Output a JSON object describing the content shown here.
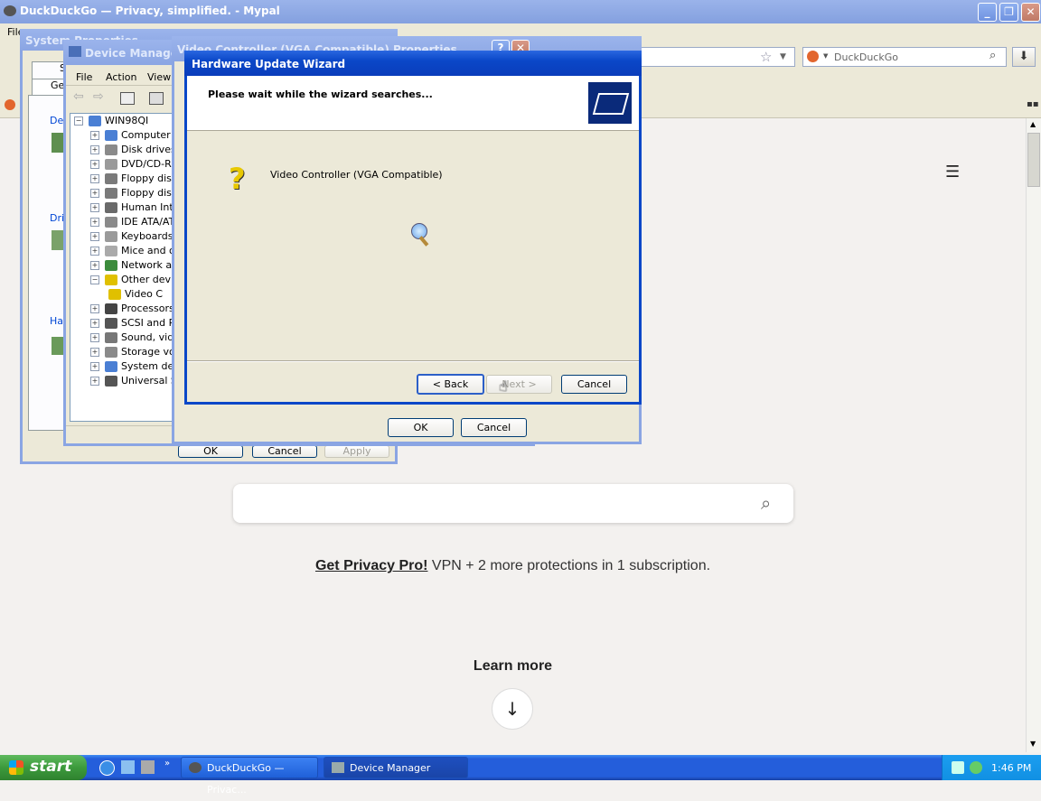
{
  "browser": {
    "title": "DuckDuckGo — Privacy, simplified. - Mypal",
    "menu_file": "File",
    "search_placeholder": "DuckDuckGo"
  },
  "ddg_page": {
    "privacy_link": "Get Privacy Pro!",
    "privacy_text": " VPN + 2 more protections in 1 subscription.",
    "learn_more": "Learn more"
  },
  "system_properties": {
    "title": "System Properties",
    "tab_partial": "Ge",
    "tab2_partial": "S",
    "group1": "Dev",
    "group2": "Driv",
    "group3": "Har",
    "ok": "OK",
    "cancel": "Cancel",
    "apply": "Apply"
  },
  "device_manager": {
    "title": "Device Manager",
    "menu": [
      "File",
      "Action",
      "View"
    ],
    "root": "WIN98QI",
    "items": [
      {
        "label": "Computer",
        "color": "#4a7fd4"
      },
      {
        "label": "Disk drives",
        "color": "#8a8a8a"
      },
      {
        "label": "DVD/CD-RO",
        "color": "#9a9a9a"
      },
      {
        "label": "Floppy disk",
        "color": "#7a7a7a"
      },
      {
        "label": "Floppy disk",
        "color": "#7a7a7a"
      },
      {
        "label": "Human Inte",
        "color": "#6a6a6a"
      },
      {
        "label": "IDE ATA/AT",
        "color": "#8a8a8a"
      },
      {
        "label": "Keyboards",
        "color": "#9a9a9a"
      },
      {
        "label": "Mice and ot",
        "color": "#aaaaaa"
      },
      {
        "label": "Network ac",
        "color": "#3c8c3c"
      },
      {
        "label": "Other devic",
        "color": "#e0c000"
      },
      {
        "label": "Video C",
        "color": "#e0c000"
      },
      {
        "label": "Processors",
        "color": "#444444"
      },
      {
        "label": "SCSI and R",
        "color": "#555555"
      },
      {
        "label": "Sound, vide",
        "color": "#777777"
      },
      {
        "label": "Storage vo",
        "color": "#8a8a8a"
      },
      {
        "label": "System dev",
        "color": "#4a7fd4"
      },
      {
        "label": "Universal S",
        "color": "#555555"
      }
    ]
  },
  "vga_properties": {
    "title": "Video Controller (VGA Compatible) Properties",
    "ok": "OK",
    "cancel": "Cancel"
  },
  "wizard": {
    "title": "Hardware Update Wizard",
    "heading": "Please wait while the wizard searches...",
    "device": "Video Controller (VGA Compatible)",
    "back": "< Back",
    "next": "Next >",
    "cancel": "Cancel"
  },
  "taskbar": {
    "start": "start",
    "tasks": [
      "DuckDuckGo — Privac...",
      "Device Manager"
    ],
    "time": "1:46 PM"
  }
}
